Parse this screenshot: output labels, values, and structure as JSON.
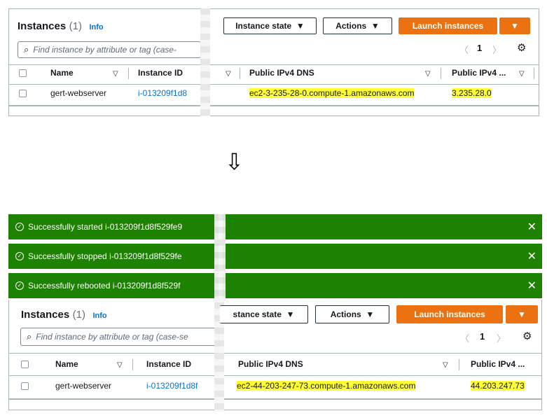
{
  "before": {
    "title": "Instances",
    "count": "(1)",
    "info": "Info",
    "search_placeholder": "Find instance by attribute or tag (case-",
    "instance_state_btn": "Instance state",
    "actions_btn": "Actions",
    "launch_btn": "Launch instances",
    "page": "1",
    "columns": {
      "name": "Name",
      "instance_id": "Instance ID",
      "dns": "Public IPv4 DNS",
      "ip": "Public IPv4 ..."
    },
    "row": {
      "name": "gert-webserver",
      "instance_id": "i-013209f1d8",
      "dns": "ec2-3-235-28-0.compute-1.amazonaws.com",
      "ip": "3.235.28.0"
    }
  },
  "arrow": "⇩",
  "after": {
    "flashes": [
      "Successfully started i-013209f1d8f529fe9",
      "Successfully stopped i-013209f1d8f529fe",
      "Successfully rebooted i-013209f1d8f529f"
    ],
    "title": "Instances",
    "count": "(1)",
    "info": "Info",
    "search_placeholder": "Find instance by attribute or tag (case-se",
    "instance_state_btn": "stance state",
    "actions_btn": "Actions",
    "launch_btn": "Launch instances",
    "page": "1",
    "columns": {
      "name": "Name",
      "instance_id": "Instance ID",
      "dns": "Public IPv4 DNS",
      "ip": "Public IPv4 ..."
    },
    "row": {
      "name": "gert-webserver",
      "instance_id": "i-013209f1d8f",
      "dns": "ec2-44-203-247-73.compute-1.amazonaws.com",
      "ip": "44.203.247.73"
    }
  },
  "colors": {
    "highlight": "#ffff33",
    "success": "#1d8102",
    "primary": "#ec7211",
    "link": "#0972d3"
  }
}
